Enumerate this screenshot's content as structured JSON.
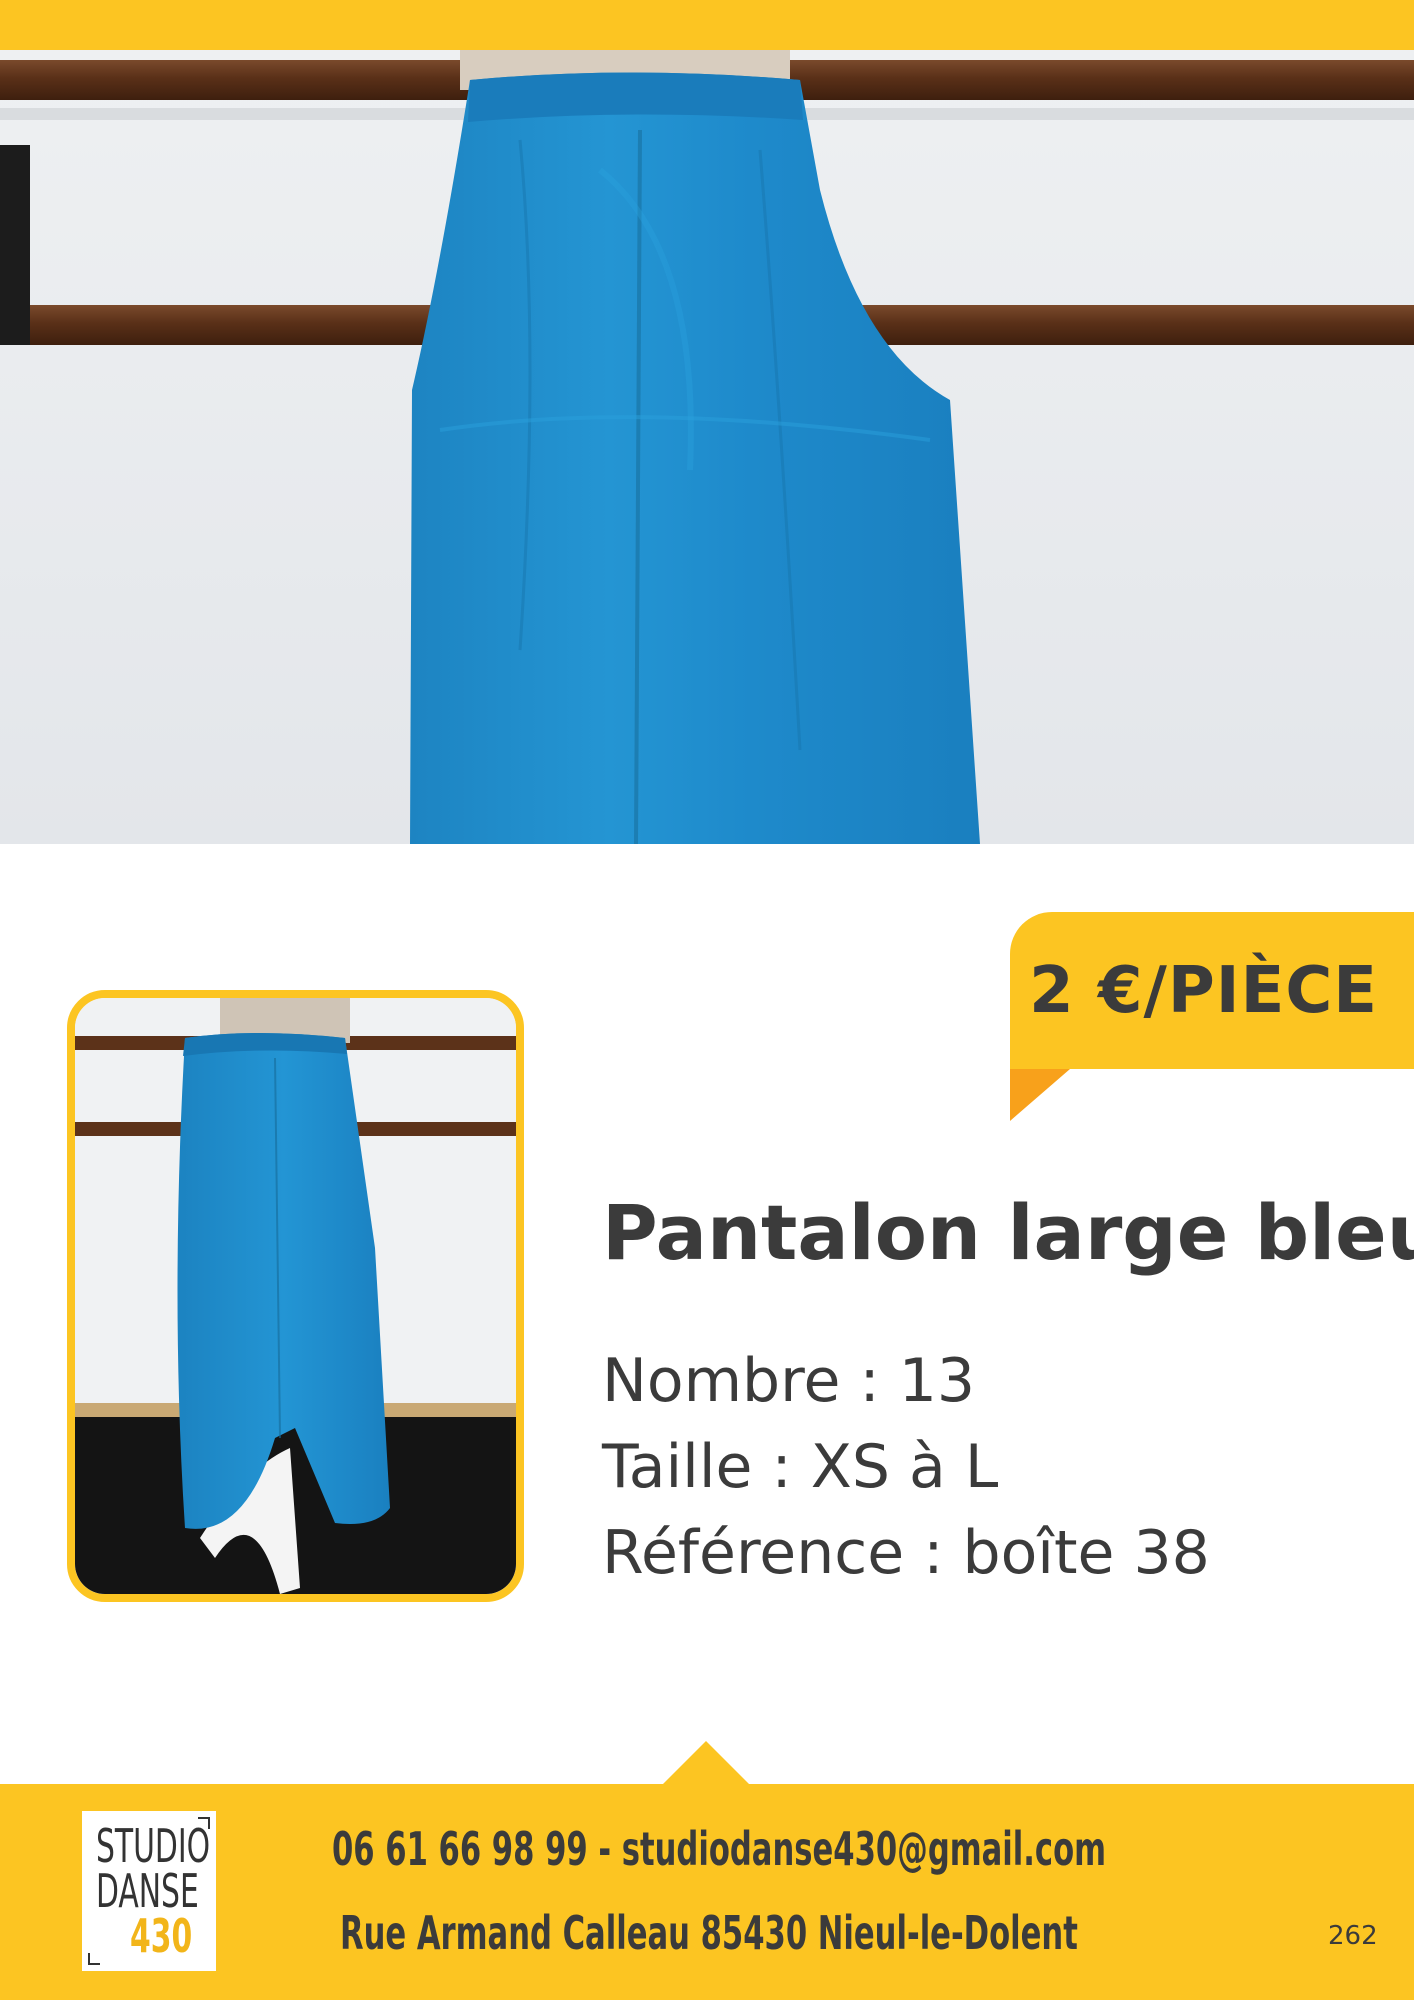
{
  "price": {
    "label": "2 €/PIÈCE"
  },
  "product": {
    "title": "Pantalon large bleu",
    "count": "Nombre : 13",
    "size": "Taille : XS à L",
    "reference": "Référence : boîte 38"
  },
  "logo": {
    "line1": "STUDIO",
    "line2": "DANSE",
    "line3": "430"
  },
  "footer": {
    "contact": "06 61 66 98 99 - studiodanse430@gmail.com",
    "address": "Rue Armand Calleau 85430 Nieul-le-Dolent",
    "page_number": "262"
  },
  "colors": {
    "accent": "#fcc522",
    "accent_dark": "#f8a11b",
    "text": "#3b3b3b",
    "garment": "#1f8ccb"
  },
  "images": {
    "hero": "blue-trousers-photo",
    "thumbnail": "blue-trousers-full-photo"
  }
}
